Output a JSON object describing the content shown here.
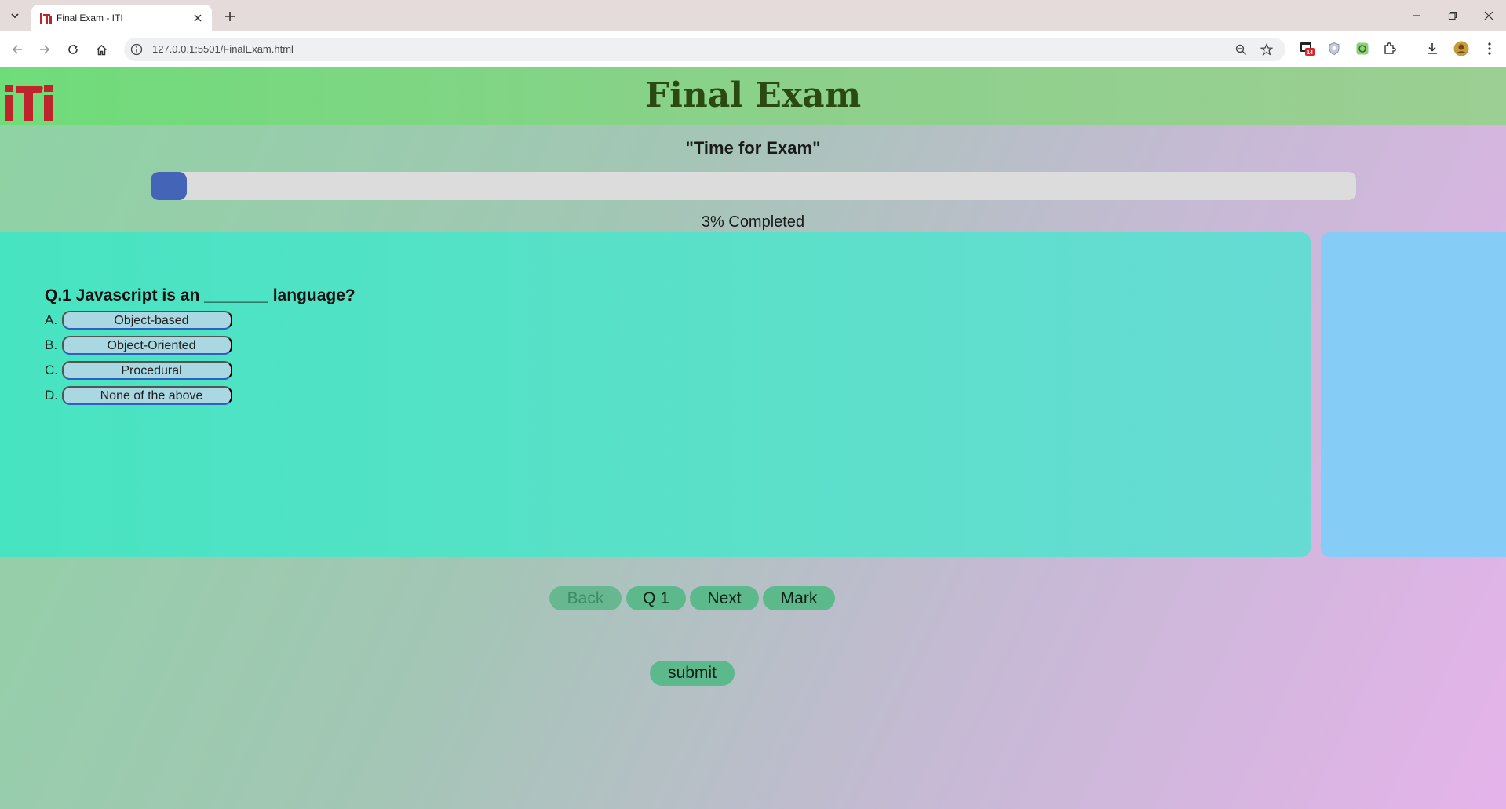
{
  "browser": {
    "tab_title": "Final Exam - ITI",
    "url": "127.0.0.1:5501/FinalExam.html",
    "extension_badge": "14"
  },
  "header": {
    "title": "Final Exam"
  },
  "subtitle": "\"Time for Exam\"",
  "progress": {
    "percent": 3,
    "label": "3% Completed"
  },
  "question": {
    "text": "Q.1 Javascript is an _______ language?",
    "options": [
      {
        "letter": "A.",
        "label": "Object-based"
      },
      {
        "letter": "B.",
        "label": "Object-Oriented"
      },
      {
        "letter": "C.",
        "label": "Procedural"
      },
      {
        "letter": "D.",
        "label": "None of the above"
      }
    ]
  },
  "navigation": {
    "back_label": "Back",
    "question_label": "Q 1",
    "next_label": "Next",
    "mark_label": "Mark"
  },
  "submit_label": "submit",
  "colors": {
    "accent": "#4464b8",
    "button": "#5cb98b",
    "title": "#2a4a12",
    "logo": "#c0242b"
  }
}
